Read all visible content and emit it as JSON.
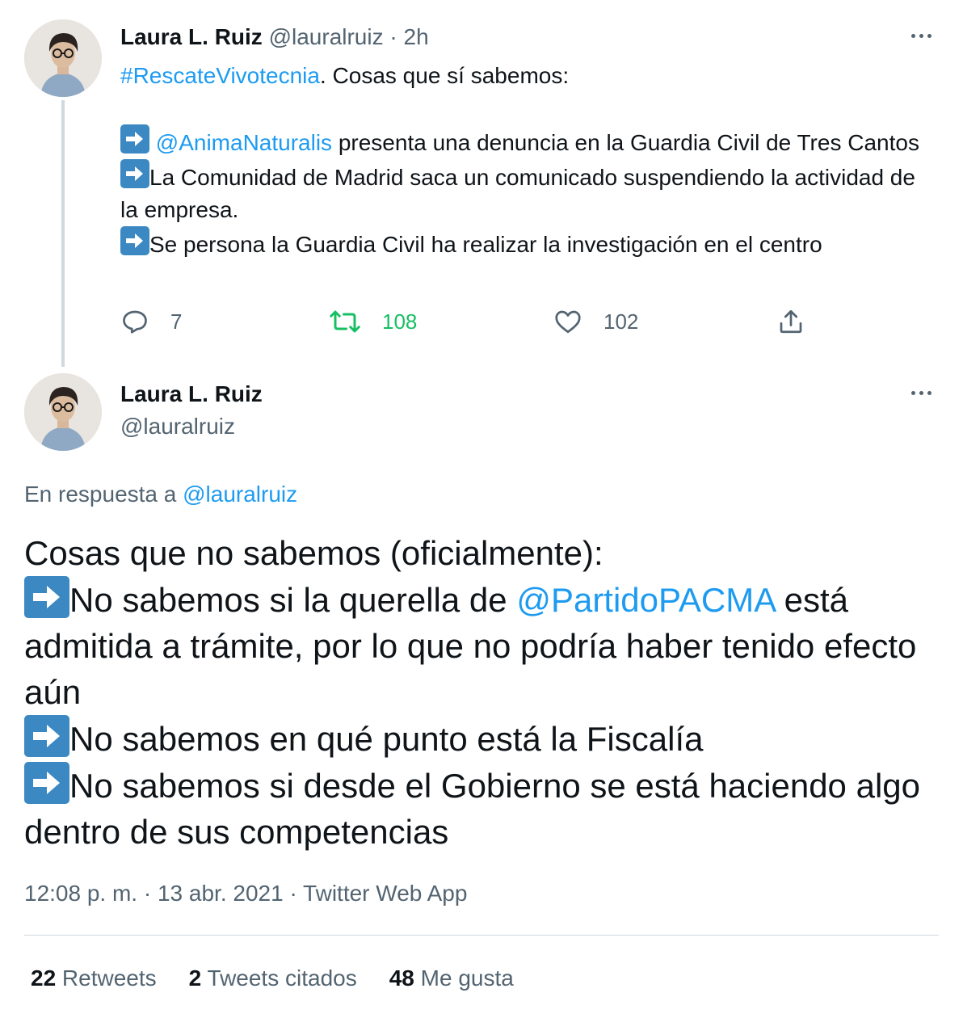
{
  "tweet1": {
    "name": "Laura L. Ruiz",
    "handle": "@lauralruiz",
    "separator": " · ",
    "time": "2h",
    "hashtag": "#RescateVivotecnia",
    "line1_rest": ". Cosas que sí sabemos:",
    "mention": "@AnimaNaturalis",
    "item1_rest": " presenta una denuncia en la Guardia Civil de Tres Cantos",
    "item2": "La Comunidad de Madrid saca un comunicado suspendiendo la actividad de la empresa.",
    "item3": "Se persona la Guardia Civil ha realizar la investigación en el centro",
    "replies": "7",
    "retweets": "108",
    "likes": "102",
    "icons": [
      "reply-icon",
      "retweet-icon",
      "like-icon",
      "share-icon",
      "more-icon",
      "arrow-right-emoji"
    ],
    "colors": {
      "link": "#1d9bf0",
      "retweet_active": "#17bf63",
      "muted": "#536471"
    }
  },
  "tweet2": {
    "name": "Laura L. Ruiz",
    "handle": "@lauralruiz",
    "reply_prefix": "En respuesta a ",
    "reply_handle": "@lauralruiz",
    "line1": "Cosas que no sabemos (oficialmente):",
    "item1_pre": "No sabemos si la querella de ",
    "item1_mention": "@PartidoPACMA",
    "item1_post": " está admitida a trámite, por lo que no podría haber tenido efecto aún",
    "item2": "No sabemos en qué punto está la Fiscalía",
    "item3": "No sabemos si desde el Gobierno se está haciendo algo dentro de sus competencias",
    "meta": "12:08 p. m. · 13 abr. 2021 · Twitter Web App",
    "stats": {
      "retweets_count": "22",
      "retweets_label": " Retweets",
      "quotes_count": "2",
      "quotes_label": " Tweets citados",
      "likes_count": "48",
      "likes_label": " Me gusta"
    }
  }
}
